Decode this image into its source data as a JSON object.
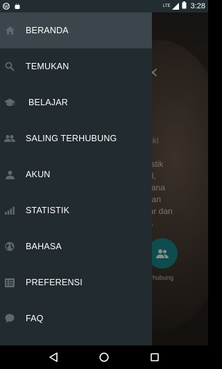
{
  "status_bar": {
    "time": "3:28",
    "network_label": "LTE",
    "icons": [
      "wordpress-icon",
      "android-icon",
      "lte-signal-icon",
      "battery-icon"
    ]
  },
  "background": {
    "text_lines": [
      "k",
      "iliki",
      "listik",
      "al,",
      "cana",
      "dan",
      "jar dan",
      "k."
    ],
    "fab_label": "erhubung"
  },
  "drawer": {
    "items": [
      {
        "label": "BERANDA",
        "icon": "home-icon",
        "active": true
      },
      {
        "label": "TEMUKAN",
        "icon": "search-icon",
        "active": false
      },
      {
        "label": "BELAJAR",
        "icon": "graduation-cap-icon",
        "active": false
      },
      {
        "label": "SALING TERHUBUNG",
        "icon": "people-icon",
        "active": false
      },
      {
        "label": "AKUN",
        "icon": "person-icon",
        "active": false
      },
      {
        "label": "STATISTIK",
        "icon": "bar-chart-icon",
        "active": false
      },
      {
        "label": "BAHASA",
        "icon": "globe-icon",
        "active": false
      },
      {
        "label": "PREFERENSI",
        "icon": "settings-list-icon",
        "active": false
      },
      {
        "label": "FAQ",
        "icon": "chat-bubble-icon",
        "active": false
      }
    ]
  },
  "nav_bar": {
    "buttons": [
      "back-icon",
      "home-circle-icon",
      "recents-icon"
    ]
  },
  "colors": {
    "drawer_bg": "#212b30",
    "active_item_bg": "#3a464b",
    "icon_color": "#5c6a70",
    "accent": "#1b8a8f"
  }
}
